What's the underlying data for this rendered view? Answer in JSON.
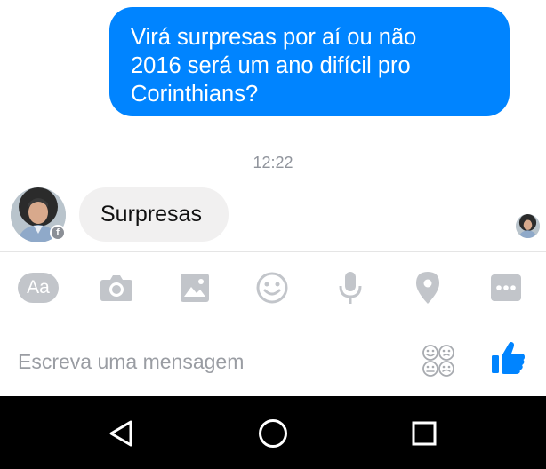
{
  "conversation": {
    "outgoing_message": "Virá surpresas por aí ou não\n2016 será um ano difícil pro\nCorinthians?",
    "timestamp": "12:22",
    "incoming_message": "Surpresas"
  },
  "toolbar": {
    "items": [
      {
        "icon": "text-format-icon",
        "label": "Aa"
      },
      {
        "icon": "camera-icon"
      },
      {
        "icon": "gallery-icon"
      },
      {
        "icon": "emoji-icon"
      },
      {
        "icon": "microphone-icon"
      },
      {
        "icon": "location-icon"
      },
      {
        "icon": "more-icon"
      }
    ],
    "icon_color": "#c2c5ca"
  },
  "composer": {
    "placeholder": "Escreva uma mensagem",
    "value": ""
  },
  "colors": {
    "outgoing_bubble": "#0084ff",
    "incoming_bubble": "#f1f0f0",
    "like_button": "#0084ff",
    "navbar": "#000000"
  }
}
